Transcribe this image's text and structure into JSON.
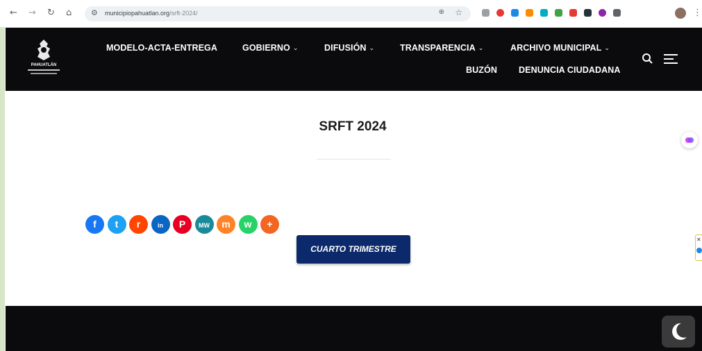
{
  "browser": {
    "back_icon": "arrow-left-icon",
    "forward_icon": "arrow-right-icon",
    "reload_icon": "reload-icon",
    "home_icon": "home-icon",
    "url_host": "municipiopahuatlan.org",
    "url_path": "/srft-2024/",
    "zoom_icon": "zoom-icon",
    "bookmark_icon": "star-icon",
    "extensions": [
      {
        "name": "play-extension-icon",
        "color": "#9aa0a6"
      },
      {
        "name": "record-extension-icon",
        "color": "#e53935"
      },
      {
        "name": "grid-extension-icon",
        "color": "#1e88e5"
      },
      {
        "name": "stack-extension-icon",
        "color": "#fb8c00"
      },
      {
        "name": "cloud-extension-icon",
        "color": "#00acc1"
      },
      {
        "name": "doc-extension-icon",
        "color": "#43a047"
      },
      {
        "name": "tampermonkey-extension-icon",
        "color": "#e53935"
      },
      {
        "name": "photo-extension-icon",
        "color": "#263238"
      },
      {
        "name": "purple-extension-icon",
        "color": "#8e24aa"
      },
      {
        "name": "puzzle-extension-icon",
        "color": "#5f6368"
      }
    ],
    "profile_icon": "avatar-icon",
    "menu_icon": "more-vert-icon"
  },
  "header": {
    "logo_text": "PAHUATLÁN",
    "nav": [
      {
        "label": "MODELO-ACTA-ENTREGA",
        "dropdown": false
      },
      {
        "label": "GOBIERNO",
        "dropdown": true
      },
      {
        "label": "DIFUSIÓN",
        "dropdown": true
      },
      {
        "label": "TRANSPARENCIA",
        "dropdown": true
      },
      {
        "label": "ARCHIVO MUNICIPAL",
        "dropdown": true
      },
      {
        "label": "BUZÓN",
        "dropdown": false
      },
      {
        "label": "DENUNCIA CIUDADANA",
        "dropdown": false
      }
    ],
    "search_icon": "search-icon",
    "menu_icon": "hamburger-menu-icon"
  },
  "main": {
    "title": "SRFT 2024",
    "share_buttons": [
      {
        "name": "share-facebook-button",
        "icon": "facebook-icon",
        "glyph": "f",
        "color": "#1877f2"
      },
      {
        "name": "share-twitter-button",
        "icon": "twitter-icon",
        "glyph": "t",
        "color": "#1da1f2"
      },
      {
        "name": "share-reddit-button",
        "icon": "reddit-icon",
        "glyph": "r",
        "color": "#ff4500"
      },
      {
        "name": "share-linkedin-button",
        "icon": "linkedin-icon",
        "glyph": "in",
        "color": "#0a66c2"
      },
      {
        "name": "share-pinterest-button",
        "icon": "pinterest-icon",
        "glyph": "P",
        "color": "#e60023"
      },
      {
        "name": "share-mewe-button",
        "icon": "mewe-icon",
        "glyph": "MW",
        "color": "#1a8a9a"
      },
      {
        "name": "share-mix-button",
        "icon": "mix-icon",
        "glyph": "m",
        "color": "#ff8226"
      },
      {
        "name": "share-whatsapp-button",
        "icon": "whatsapp-icon",
        "glyph": "w",
        "color": "#25d366"
      },
      {
        "name": "share-more-button",
        "icon": "plus-icon",
        "glyph": "+",
        "color": "#f26522"
      }
    ],
    "cta_label": "CUARTO TRIMESTRE",
    "cta_color": "#0c2a6b"
  },
  "colors": {
    "header_bg": "#0b0b0d",
    "footer_bg": "#0b0b0d"
  },
  "dark_mode_icon": "moon-icon"
}
